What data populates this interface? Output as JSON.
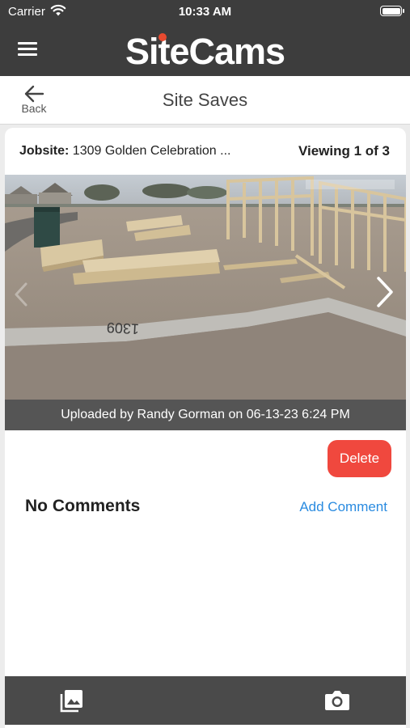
{
  "status_bar": {
    "carrier": "Carrier",
    "time": "10:33 AM",
    "wifi_icon": "wifi-icon",
    "battery_icon": "battery-icon"
  },
  "app_header": {
    "logo": "SiteCams",
    "menu_icon": "hamburger-menu-icon",
    "background_color": "#3d3d3d",
    "logo_dot_color": "#e84a2f"
  },
  "subheader": {
    "back_label": "Back",
    "back_icon": "arrow-left-icon",
    "title": "Site Saves"
  },
  "card": {
    "jobsite_label": "Jobsite:",
    "jobsite_value": "1309 Golden Celebration ...",
    "viewing": "Viewing 1 of 3",
    "photo": {
      "overlay_text": "1309",
      "next_icon": "chevron-right-icon",
      "prev_icon": "chevron-left-icon"
    },
    "caption": "Uploaded by Randy Gorman on 06-13-23 6:24 PM",
    "delete_label": "Delete",
    "delete_color": "#f0483e",
    "comments_heading": "No Comments",
    "add_comment_label": "Add Comment",
    "link_color": "#2a8be0"
  },
  "tabbar": {
    "gallery_icon": "photo-gallery-icon",
    "camera_icon": "camera-icon",
    "background_color": "#4a4a4a"
  }
}
